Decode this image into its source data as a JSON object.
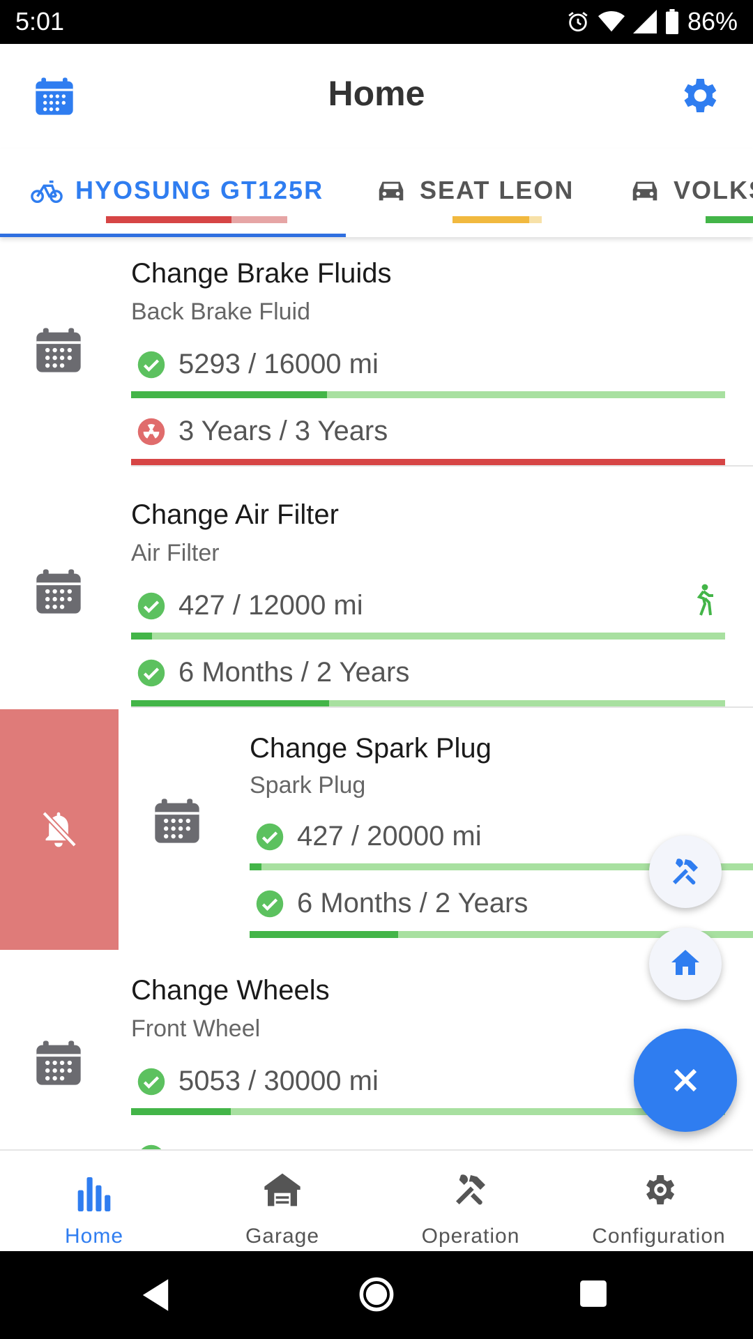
{
  "status_bar": {
    "time": "5:01",
    "battery": "86%"
  },
  "header": {
    "title": "Home"
  },
  "tabs": [
    {
      "label": "HYOSUNG GT125R",
      "icon": "bicycle-icon",
      "active": true
    },
    {
      "label": "SEAT LEON",
      "icon": "car-icon",
      "active": false
    },
    {
      "label": "VOLKS",
      "icon": "car-icon",
      "active": false
    }
  ],
  "items": [
    {
      "title": "Change Brake Fluids",
      "subtitle": "Back Brake Fluid",
      "distance": "5293 / 16000 mi",
      "distance_progress": 0.33,
      "distance_status": "ok",
      "time": "3 Years / 3 Years",
      "time_progress": 1.0,
      "time_status": "overdue"
    },
    {
      "title": "Change Air Filter",
      "subtitle": "Air Filter",
      "distance": "427 / 12000 mi",
      "distance_progress": 0.04,
      "distance_status": "ok",
      "time": "6 Months / 2 Years",
      "time_progress": 0.25,
      "time_status": "ok",
      "extra_icon": "walking-icon"
    },
    {
      "title": "Change Spark Plug",
      "subtitle": "Spark Plug",
      "distance": "427 / 20000 mi",
      "distance_progress": 0.02,
      "distance_status": "ok",
      "time": "6 Months / 2 Years",
      "time_progress": 0.25,
      "time_status": "ok",
      "swipe_action": "mute-notification"
    },
    {
      "title": "Change Wheels",
      "subtitle": "Front Wheel",
      "distance": "5053 / 30000 mi",
      "distance_progress": 0.17,
      "distance_status": "ok"
    }
  ],
  "bottom_nav": [
    {
      "label": "Home",
      "icon": "bar-chart-icon",
      "active": true
    },
    {
      "label": "Garage",
      "icon": "garage-icon",
      "active": false
    },
    {
      "label": "Operation",
      "icon": "tools-icon",
      "active": false
    },
    {
      "label": "Configuration",
      "icon": "gear-icon",
      "active": false
    }
  ],
  "colors": {
    "accent": "#2f7df0",
    "ok": "#43b548",
    "ok_light": "#a8e0a0",
    "danger": "#d64545",
    "icon_grey": "#6b6b70"
  }
}
